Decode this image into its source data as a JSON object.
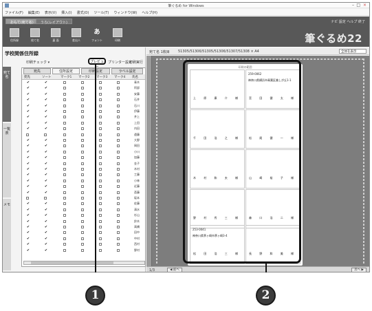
{
  "window": {
    "title": "筆ぐるめ for Windows",
    "controls": [
      "–",
      "□",
      "×"
    ]
  },
  "menu": [
    "ファイル(F)",
    "編集(E)",
    "表示(V)",
    "挿入(I)",
    "書式(O)",
    "ツール(T)",
    "ウィンドウ(W)",
    "ヘルプ(H)"
  ],
  "ribbon": {
    "tabs": [
      "おもて(宛て名)",
      "うら(レイアウト)"
    ],
    "tools": [
      "住所録",
      "宛て名",
      "裏 面",
      "差出人",
      "フォント",
      "印刷"
    ],
    "topright": "ナビ 設定 ヘルプ 終了",
    "brand": "筆ぐるめ22"
  },
  "left": {
    "title": "学校関係住所録",
    "check_dropdown": "印刷チェック ▾",
    "preview_button": "プレビュー",
    "printer_settings": "プリンター設定",
    "print_execute": "印刷実行",
    "vtabs": [
      "宛て名",
      "一覧表",
      "メモ"
    ],
    "table_tabs": [
      "宛先",
      "住所設定",
      "印刷設定",
      "ラベル設定"
    ],
    "columns": [
      "宛先",
      "ソート",
      "マーク1",
      "マーク2",
      "マーク3",
      "マーク4",
      "氏名"
    ],
    "row_names": [
      "青木",
      "阿部",
      "安藤",
      "石井",
      "石川",
      "伊藤",
      "井上",
      "上田",
      "内田",
      "遠藤",
      "大野",
      "岡田",
      "小川",
      "加藤",
      "金子",
      "木村",
      "工藤",
      "小林",
      "近藤",
      "斎藤",
      "坂本",
      "佐藤",
      "清水",
      "杉山",
      "鈴木",
      "高橋",
      "田中",
      "中村",
      "西村",
      "野村"
    ]
  },
  "address_bar": {
    "label": "宛て名 1枚目",
    "range": "51305/51306/51305/51306/51307/51308 × A4",
    "zoom": "全体を表示"
  },
  "sheet": {
    "title": "印刷の範囲",
    "labels": [
      {
        "zip": "259-0062",
        "addr": "神奈川県横浜市青葉区美しが丘1-1",
        "name": "上 原 康 介 様",
        "name2": "宮 田 健 太 様"
      },
      {
        "zip": "",
        "addr": "",
        "name": "千 田 浩 之 様",
        "name2": "松 尾 健 一 様"
      },
      {
        "zip": "",
        "addr": "",
        "name": "木 村 和 夫 様",
        "name2": "山 崎 裕 子 様"
      },
      {
        "zip": "",
        "addr": "",
        "name": "野 村 秀 三 様",
        "name2": "森 口 浩 二 様"
      },
      {
        "zip": "253-0041",
        "addr": "神奈川県茅ヶ崎市茅ヶ崎3-4",
        "name": "松 田 浩 三 様",
        "name2": "長 野 和 美 様"
      }
    ]
  },
  "bottom": {
    "page": "1/3",
    "left_btn": "◀ 前へ",
    "right_btn": "次へ ▶"
  },
  "callouts": {
    "one": "1",
    "two": "2"
  }
}
